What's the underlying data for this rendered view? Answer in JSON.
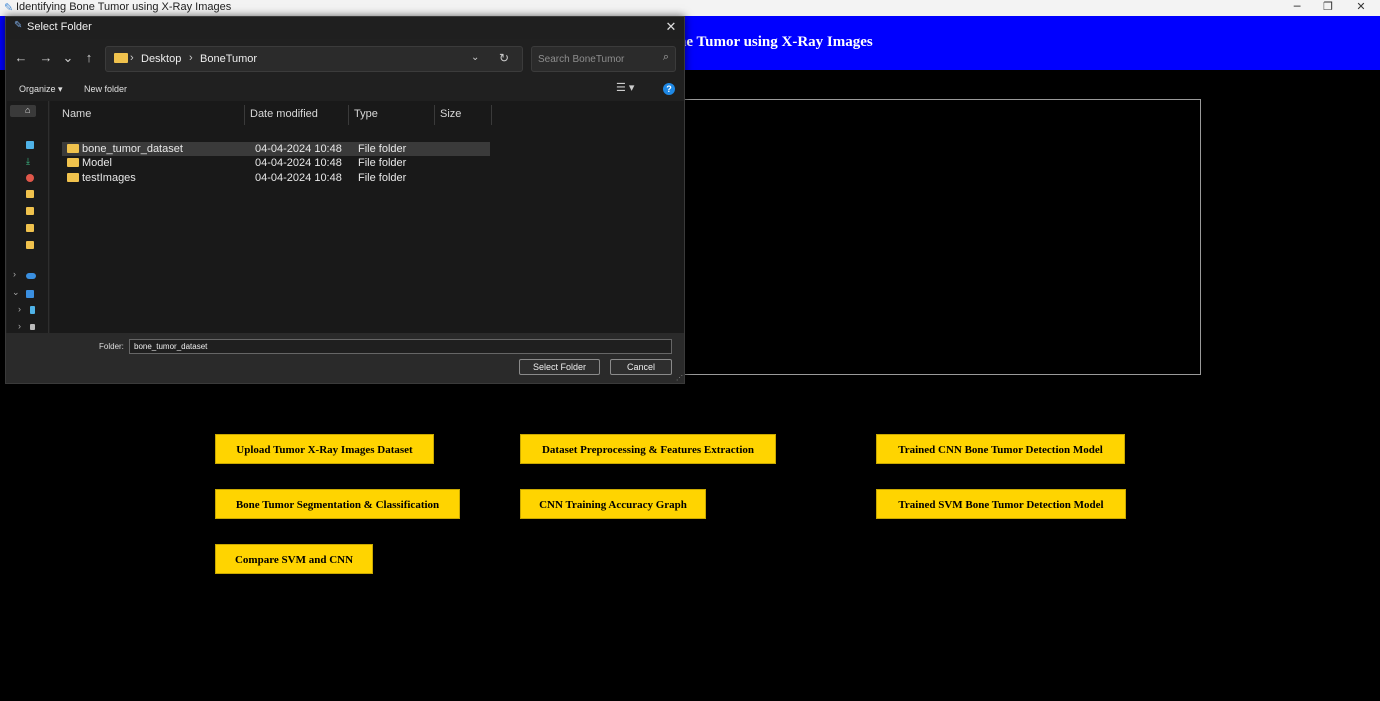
{
  "window": {
    "title": "Identifying Bone Tumor using X-Ray Images",
    "minimize": "─",
    "restore": "❐",
    "close": "✕"
  },
  "header": {
    "visible_text": "ne Tumor using X-Ray Images",
    "background": "#0000ff"
  },
  "buttons": {
    "upload": "Upload Tumor X-Ray Images Dataset",
    "preprocess": "Dataset Preprocessing & Features Extraction",
    "trained_cnn": "Trained CNN Bone Tumor Detection Model",
    "segmentation": "Bone Tumor Segmentation & Classification",
    "cnn_graph": "CNN Training Accuracy Graph",
    "trained_svm": "Trained SVM Bone Tumor Detection Model",
    "compare": "Compare SVM and CNN",
    "color": "#ffd400"
  },
  "dialog": {
    "title": "Select Folder",
    "nav": {
      "back": "←",
      "forward": "→",
      "recent": "⌄",
      "up": "↑"
    },
    "breadcrumb": [
      "Desktop",
      "BoneTumor"
    ],
    "search_placeholder": "Search BoneTumor",
    "toolbar": {
      "organize": "Organize ▾",
      "new_folder": "New folder"
    },
    "columns": [
      "Name",
      "Date modified",
      "Type",
      "Size"
    ],
    "files": [
      {
        "name": "bone_tumor_dataset",
        "date": "04-04-2024 10:48",
        "type": "File folder"
      },
      {
        "name": "Model",
        "date": "04-04-2024 10:48",
        "type": "File folder"
      },
      {
        "name": "testImages",
        "date": "04-04-2024 10:48",
        "type": "File folder"
      }
    ],
    "folder_label": "Folder:",
    "folder_value": "bone_tumor_dataset",
    "select_button": "Select Folder",
    "cancel_button": "Cancel"
  }
}
